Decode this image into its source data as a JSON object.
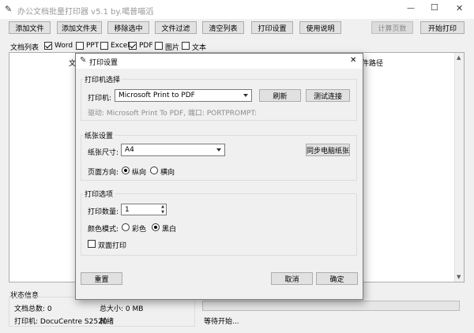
{
  "window": {
    "title": "办公文档批量打印器 v5.1 by.噶普喵滔",
    "controls": {
      "minimize": "—",
      "maximize": "☐",
      "close": "✕"
    }
  },
  "toolbar": {
    "add_file": "添加文件",
    "add_folder": "添加文件夹",
    "remove_selected": "移除选中",
    "file_filter": "文件过滤",
    "clear_list": "清空列表",
    "print_settings": "打印设置",
    "help": "使用说明",
    "count_pages": "计算页数",
    "start_print": "开始打印"
  },
  "filters": {
    "label": "文档列表",
    "items": [
      {
        "label": "Word",
        "checked": true
      },
      {
        "label": "PPT",
        "checked": false
      },
      {
        "label": "Excel",
        "checked": false
      },
      {
        "label": "PDF",
        "checked": true
      },
      {
        "label": "图片",
        "checked": false
      },
      {
        "label": "文本",
        "checked": false
      }
    ]
  },
  "table": {
    "col_left_fragment": "文",
    "col_right_fragment": "件路径"
  },
  "status": {
    "title": "状态信息",
    "doc_count": "文档总数: 0",
    "total_size": "总大小: 0 MB",
    "printer": "打印机: DocuCentre S2520",
    "ready": "就绪",
    "progress_text": "等待开始...",
    "progress_fraction": 0
  },
  "dialog": {
    "title": "打印设置",
    "close": "✕",
    "printer_section": {
      "title": "打印机选择",
      "printer_label": "打印机:",
      "printer_value": "Microsoft Print to PDF",
      "refresh": "刷新",
      "test_connection": "测试连接",
      "driver_info": "驱动: Microsoft Print To PDF, 端口: PORTPROMPT:"
    },
    "paper_section": {
      "title": "纸张设置",
      "size_label": "纸张尺寸:",
      "size_value": "A4",
      "sync_paper": "同步电脑纸张",
      "orientation_label": "页面方向:",
      "portrait": "纵向",
      "landscape": "横向",
      "orientation_selected": "portrait"
    },
    "options_section": {
      "title": "打印选项",
      "copies_label": "打印数量:",
      "copies_value": "1",
      "color_label": "颜色模式:",
      "color": "彩色",
      "mono": "黑白",
      "color_selected": "mono",
      "duplex_label": "双面打印",
      "duplex_checked": false
    },
    "reset": "重置",
    "cancel": "取消",
    "ok": "确定"
  }
}
